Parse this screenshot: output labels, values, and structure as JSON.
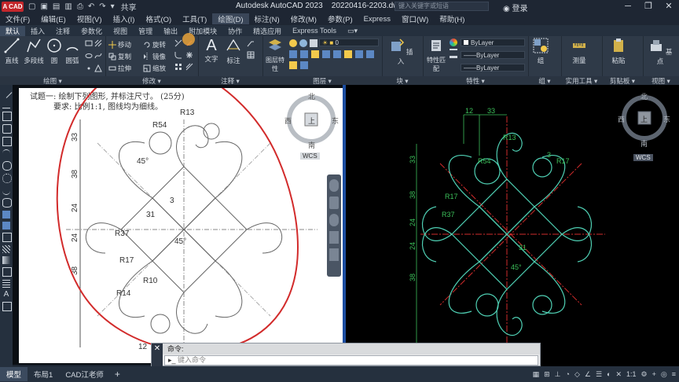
{
  "titlebar": {
    "logo": "A CAD",
    "share": "共享",
    "app_title": "Autodesk AutoCAD 2023",
    "file_name": "20220416-2203.dwg",
    "search_placeholder": "键入关键字或短语",
    "login": "登录"
  },
  "menu": [
    "文件(F)",
    "编辑(E)",
    "视图(V)",
    "插入(I)",
    "格式(O)",
    "工具(T)",
    "绘图(D)",
    "标注(N)",
    "修改(M)",
    "参数(P)",
    "Express",
    "窗口(W)",
    "帮助(H)"
  ],
  "menu_active": 6,
  "tabs": [
    "默认",
    "插入",
    "注释",
    "参数化",
    "视图",
    "管理",
    "输出",
    "附加模块",
    "协作",
    "精选应用",
    "Express Tools"
  ],
  "tab_active": 0,
  "ribbon": {
    "draw_panel": "绘图",
    "modify_panel": "修改",
    "annot_panel": "注释",
    "layer_panel": "图层",
    "block_panel": "块",
    "prop_panel": "特性",
    "group_panel": "组",
    "util_panel": "实用工具",
    "clip_panel": "剪贴板",
    "view_panel": "视图",
    "line": "直线",
    "polyline": "多段线",
    "circle": "圆",
    "arc": "圆弧",
    "move": "移动",
    "rotate": "旋转",
    "copy": "复制",
    "mirror": "镜像",
    "stretch": "拉伸",
    "scale": "缩放",
    "text": "文字",
    "dim": "标注",
    "layer_props": "图层特性",
    "layer_value": "0",
    "insert": "插入",
    "match_props": "特性匹配",
    "bylayer_color": "ByLayer",
    "bylayer_ltype": "ByLayer",
    "bylayer_lweight": "ByLayer",
    "group": "组",
    "measure": "测量",
    "paste": "粘贴",
    "basepoint": "基点"
  },
  "paper": {
    "question": "试题一: 绘制下列图形, 并标注尺寸。 (25分)",
    "req": "要求: 比例1:1, 图线均为细线。",
    "dims": [
      "33",
      "38",
      "24",
      "24",
      "38",
      "12",
      "R54",
      "R13",
      "R17",
      "R37",
      "R14",
      "R10",
      "31",
      "45°",
      "45°",
      "3"
    ]
  },
  "right_dims": [
    "12",
    "33",
    "R13",
    "R54",
    "R17",
    "R17",
    "R37",
    "3",
    "33",
    "38",
    "24",
    "24",
    "38",
    "31",
    "45°"
  ],
  "viewcube": {
    "north": "北",
    "south": "南",
    "east": "东",
    "west": "西",
    "top": "上",
    "wcs": "WCS"
  },
  "command": {
    "label": "命令:",
    "prompt": "键入命令"
  },
  "status": {
    "tabs": [
      "模型",
      "布局1",
      "CAD江老师"
    ],
    "tab_active": 0,
    "scale": "1:1"
  }
}
